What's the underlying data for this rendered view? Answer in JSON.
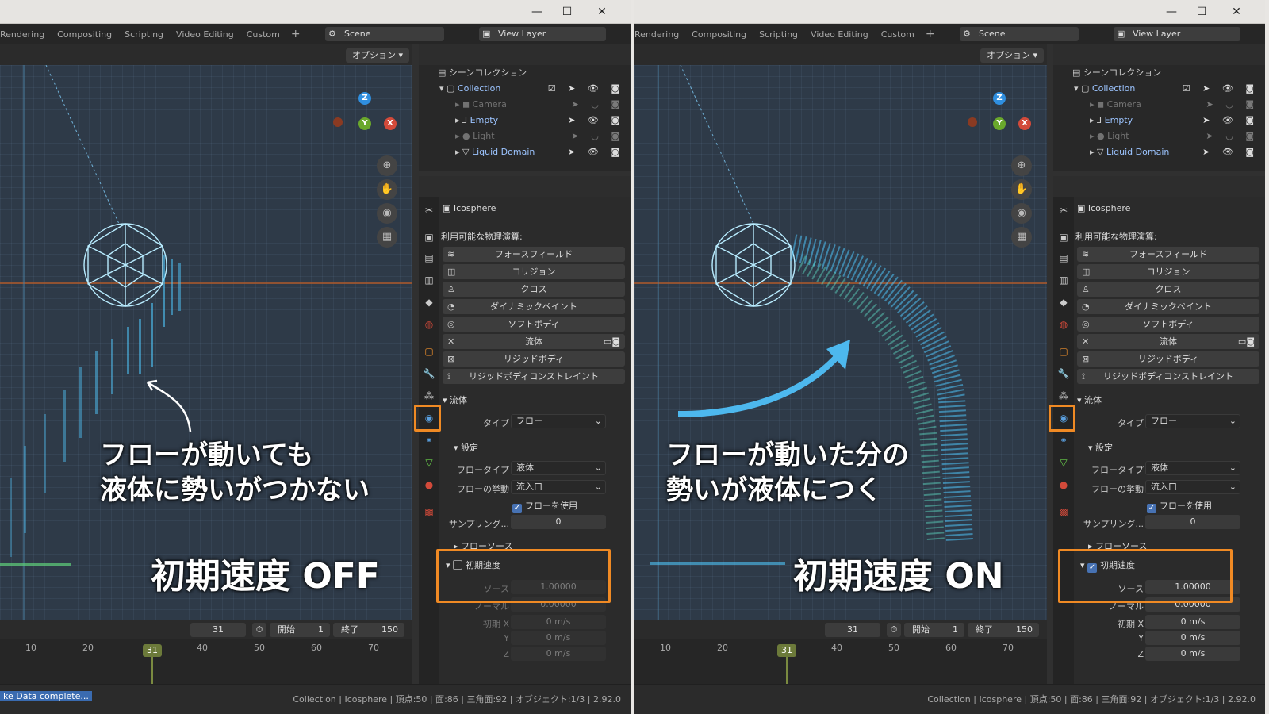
{
  "workspace_tabs": [
    "Rendering",
    "Compositing",
    "Scripting",
    "Video Editing",
    "Custom"
  ],
  "scene": "Scene",
  "view_layer": "View Layer",
  "options_label": "オプション",
  "outliner": {
    "header": "シーンコレクション",
    "collection": "Collection",
    "items": [
      "Camera",
      "Empty",
      "Light",
      "Liquid Domain"
    ]
  },
  "properties": {
    "object_name": "Icosphere",
    "available_physics_label": "利用可能な物理演算:",
    "physics_buttons": [
      "フォースフィールド",
      "コリジョン",
      "クロス",
      "ダイナミックペイント",
      "ソフトボディ",
      "流体",
      "リジッドボディ",
      "リジッドボディコンストレイント"
    ],
    "fluid_section": "流体",
    "type_label": "タイプ",
    "type_value": "フロー",
    "settings_section": "設定",
    "flow_type_label": "フロータイプ",
    "flow_type_value": "液体",
    "flow_behavior_label": "フローの挙動",
    "flow_behavior_value": "流入口",
    "use_flow_label": "フローを使用",
    "sampling_label": "サンプリング...",
    "sampling_value": "0",
    "flow_source_section": "フローソース",
    "initial_velocity_label": "初期速度",
    "source_label": "ソース",
    "source_value": "1.00000",
    "normal_label": "ノーマル",
    "normal_value": "0.00000",
    "init_x_label": "初期 X",
    "y_label": "Y",
    "z_label": "Z",
    "velocity_value": "0 m/s"
  },
  "timeline": {
    "current_frame": "31",
    "start_label": "開始",
    "start_value": "1",
    "end_label": "終了",
    "end_value": "150",
    "ticks": [
      "10",
      "20",
      "30",
      "40",
      "50",
      "60",
      "70"
    ]
  },
  "status": {
    "left_message": "ke Data complete...",
    "info": "Collection | Icosphere | 頂点:50 | 面:86 | 三角面:92 | オブジェクト:1/3 | 2.92.0"
  },
  "annotations": {
    "left_caption_line1": "フローが動いても",
    "left_caption_line2": "液体に勢いがつかない",
    "left_title": "初期速度 OFF",
    "right_caption_line1": "フローが動いた分の",
    "right_caption_line2": "勢いが液体につく",
    "right_title": "初期速度 ON"
  },
  "colors": {
    "accent_orange": "#f08a24",
    "particle_cyan": "#4fc3f7",
    "arrow_blue": "#4db8ee",
    "checkbox_blue": "#4772b3"
  }
}
